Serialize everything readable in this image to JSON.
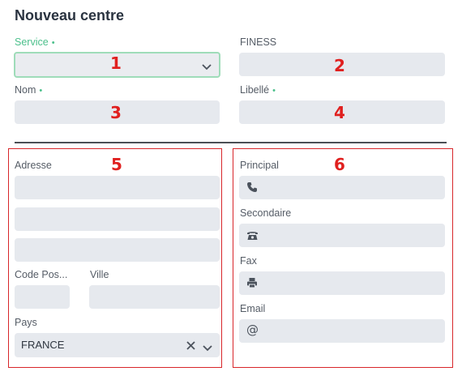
{
  "form": {
    "title": "Nouveau centre",
    "required_mark": "•",
    "fields": {
      "service": {
        "label": "Service",
        "value": ""
      },
      "finess": {
        "label": "FINESS",
        "value": ""
      },
      "nom": {
        "label": "Nom",
        "value": ""
      },
      "libelle": {
        "label": "Libellé",
        "value": ""
      }
    }
  },
  "annotations": [
    "1",
    "2",
    "3",
    "4",
    "5",
    "6"
  ],
  "address": {
    "label": "Adresse",
    "line1": "",
    "line2": "",
    "line3": "",
    "code_postal_label": "Code Pos...",
    "ville_label": "Ville",
    "pays_label": "Pays",
    "pays_value": "FRANCE"
  },
  "phones": {
    "principal_label": "Principal",
    "secondaire_label": "Secondaire",
    "fax_label": "Fax",
    "email_label": "Email",
    "icons": {
      "principal": "phone-icon",
      "secondaire": "desk-phone-icon",
      "fax": "fax-icon",
      "email": "at-icon"
    }
  },
  "colors": {
    "accent": "#4cc08c",
    "annotation": "#e0201f",
    "field_bg": "#e6e9ee"
  }
}
